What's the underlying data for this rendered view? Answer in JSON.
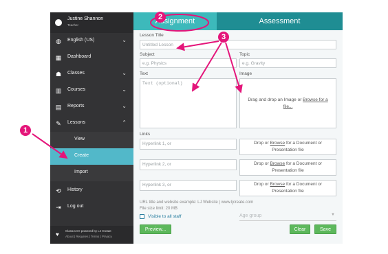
{
  "sidebar": {
    "user_name": "Justine Shannon",
    "user_role": "Teacher",
    "items": [
      {
        "label": "English (US)",
        "icon": "globe-icon",
        "chevron": "⌄"
      },
      {
        "label": "Dashboard",
        "icon": "dashboard-icon",
        "chevron": ""
      },
      {
        "label": "Classes",
        "icon": "users-icon",
        "chevron": "⌄"
      },
      {
        "label": "Courses",
        "icon": "book-icon",
        "chevron": "⌄"
      },
      {
        "label": "Reports",
        "icon": "grid-icon",
        "chevron": "⌄"
      },
      {
        "label": "Lessons",
        "icon": "pencil-icon",
        "chevron": "⌃"
      }
    ],
    "lesson_sub": [
      "View",
      "Create",
      "Import"
    ],
    "bottom_items": [
      {
        "label": "History",
        "icon": "history-icon"
      },
      {
        "label": "Log out",
        "icon": "logout-icon"
      }
    ],
    "footer_line1": "ClassAct II powered by LJ Create",
    "footer_line2": "About | Requires | Terms | Privacy"
  },
  "tabs": {
    "assignment": "Assignment",
    "assessment": "Assessment"
  },
  "form": {
    "lesson_title_label": "Lesson Title",
    "lesson_title_placeholder": "Untitled Lesson",
    "subject_label": "Subject",
    "subject_placeholder": "e.g. Physics",
    "topic_label": "Topic",
    "topic_placeholder": "e.g. Gravity",
    "text_label": "Text",
    "text_placeholder": "Text (optional)",
    "image_label": "Image",
    "image_drop_pre": "Drag and drop an Image or ",
    "image_drop_link": "Browse for a",
    "image_drop_post": "file...",
    "links_label": "Links",
    "hyperlinks": [
      "Hyperlink 1, or",
      "Hyperlink 2, or",
      "Hyperlink 3, or"
    ],
    "doc_drop_pre": "Drop or ",
    "doc_drop_link": "Browse",
    "doc_drop_post": " for a Document or",
    "doc_drop_line2": "Presentation file",
    "url_note": "URL title and website example: LJ Website | www.ljcreate.com",
    "size_note": "File size limit: 20 MB",
    "visible_label": "Visible to all staff",
    "age_group_placeholder": "Age group",
    "preview_label": "Preview...",
    "clear_label": "Clear",
    "save_label": "Save"
  },
  "callouts": [
    "1",
    "2",
    "3"
  ],
  "colors": {
    "sidebar": "#333335",
    "accent": "#52b8c9",
    "tabbar": "#1f8d93",
    "annotation": "#e4157a",
    "button": "#5db85c"
  }
}
